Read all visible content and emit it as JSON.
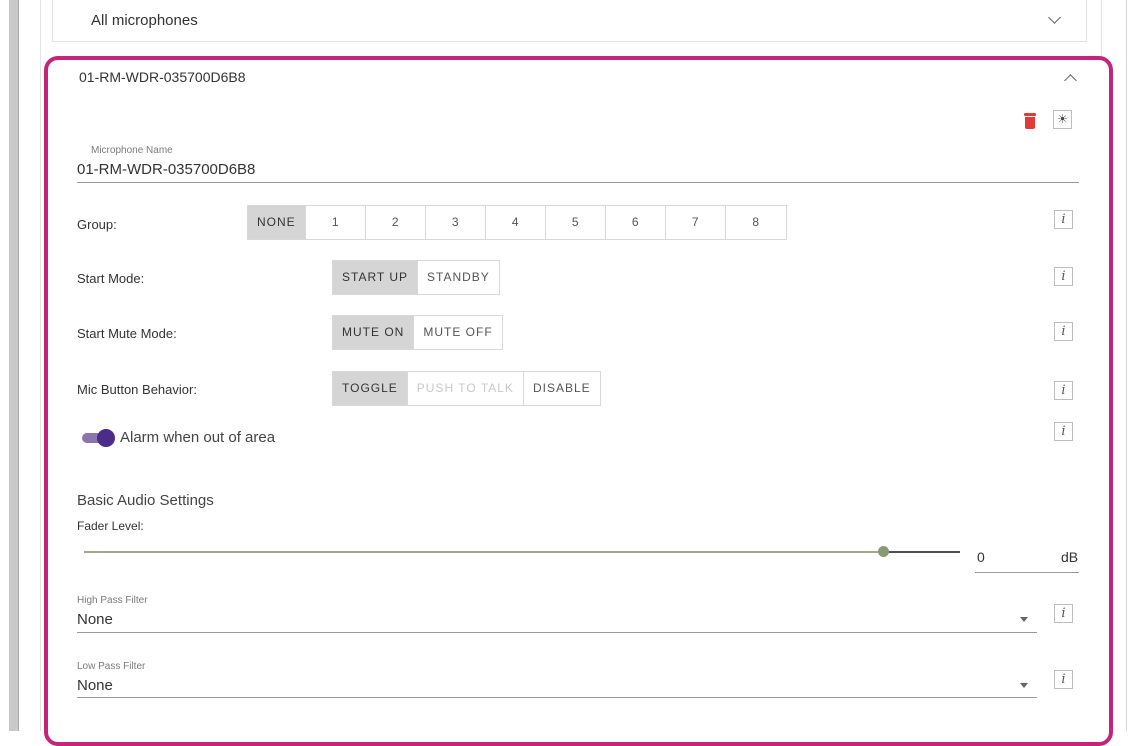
{
  "top_panel": {
    "label": "All microphones"
  },
  "card": {
    "title": "01-RM-WDR-035700D6B8",
    "delete_icon": "trash-icon",
    "identify_icon": "sun-icon",
    "identify_glyph": "☀",
    "mic_name": {
      "label": "Microphone Name",
      "value": "01-RM-WDR-035700D6B8"
    },
    "group": {
      "label": "Group:",
      "options": [
        "NONE",
        "1",
        "2",
        "3",
        "4",
        "5",
        "6",
        "7",
        "8"
      ],
      "selected": "NONE"
    },
    "start_mode": {
      "label": "Start Mode:",
      "options": [
        "START UP",
        "STANDBY"
      ],
      "selected": "START UP"
    },
    "start_mute_mode": {
      "label": "Start Mute Mode:",
      "options": [
        "MUTE ON",
        "MUTE OFF"
      ],
      "selected": "MUTE ON"
    },
    "mic_button_behavior": {
      "label": "Mic Button Behavior:",
      "options": [
        "TOGGLE",
        "PUSH TO TALK",
        "DISABLE"
      ],
      "selected": "TOGGLE",
      "disabled": [
        "PUSH TO TALK"
      ]
    },
    "alarm": {
      "label": "Alarm when out of area",
      "enabled": true
    },
    "info_glyph": "i",
    "basic_audio": {
      "heading": "Basic Audio Settings",
      "fader_label": "Fader Level:",
      "fader_value": "0",
      "fader_unit": "dB",
      "fader_fraction": 0.91
    },
    "high_pass": {
      "label": "High Pass Filter",
      "value": "None"
    },
    "low_pass": {
      "label": "Low Pass Filter",
      "value": "None"
    }
  },
  "colors": {
    "card_border": "#c5247c",
    "toggle_on": "#4c2c88",
    "delete": "#e53935",
    "slider_active": "#a2a88a"
  }
}
